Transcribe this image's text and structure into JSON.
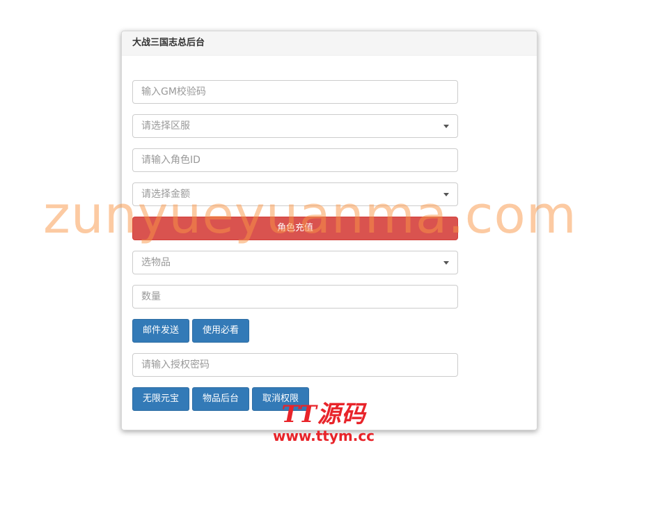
{
  "panel": {
    "title": "大战三国志总后台"
  },
  "form": {
    "gm_code_placeholder": "输入GM校验码",
    "server_select": "请选择区服",
    "role_id_placeholder": "请输入角色ID",
    "amount_select": "请选择金额",
    "recharge_button": "角色充值",
    "item_select": "选物品",
    "quantity_placeholder": "数量",
    "mail_send_button": "邮件发送",
    "usage_notes_button": "使用必看",
    "auth_password_placeholder": "请输入授权密码",
    "unlimited_ingot_button": "无限元宝",
    "item_backend_button": "物品后台",
    "revoke_permission_button": "取消权限"
  },
  "watermark": {
    "text": "zunyueyuanma.com"
  },
  "logo": {
    "brand": "TT源码",
    "url": "www.ttym.cc"
  },
  "colors": {
    "primary": "#337ab7",
    "danger": "#d9534f",
    "watermark": "#f99646",
    "logo": "#e8242a"
  },
  "icons": {
    "select_caret": "caret-down-icon"
  }
}
